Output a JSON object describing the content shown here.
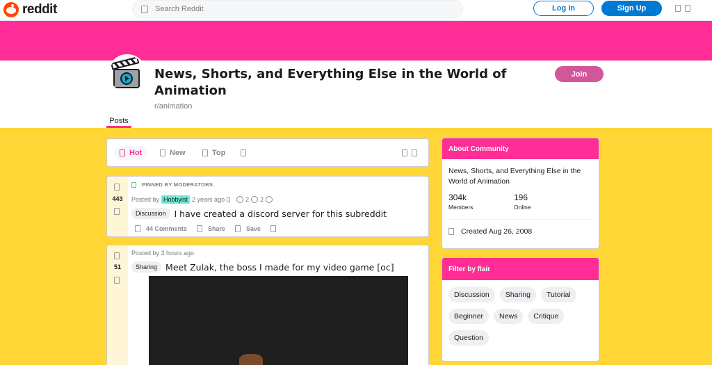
{
  "header": {
    "logo_text": "reddit",
    "search_placeholder": "Search Reddit",
    "login_label": "Log In",
    "signup_label": "Sign Up"
  },
  "colors": {
    "banner": "#ff2d95",
    "background": "#ffd635",
    "join_button": "#d2579a",
    "primary_blue": "#0079d3"
  },
  "subreddit": {
    "title": "News, Shorts, and Everything Else in the World of Animation",
    "name": "r/animation",
    "join_label": "Join",
    "tab_posts": "Posts"
  },
  "sort": {
    "hot": "Hot",
    "new": "New",
    "top": "Top"
  },
  "posts": [
    {
      "score": "443",
      "pinned_label": "PINNED BY MODERATORS",
      "posted_by": "Posted by",
      "author": "Hobbyist",
      "time": "2 years ago",
      "award_count_1": "2",
      "award_count_2": "2",
      "flair": "Discussion",
      "title": "I have created a discord server for this subreddit",
      "comments": "44 Comments",
      "share": "Share",
      "save": "Save"
    },
    {
      "score": "51",
      "posted_by": "Posted by 3 hours ago",
      "flair": "Sharing",
      "title": "Meet Zulak, the boss I made for my video game [oc]"
    }
  ],
  "about": {
    "heading": "About Community",
    "description": "News, Shorts, and Everything Else in the World of Animation",
    "members_count": "304k",
    "members_label": "Members",
    "online_count": "196",
    "online_label": "Online",
    "created": "Created Aug 26, 2008"
  },
  "flair_filter": {
    "heading": "Filter by flair",
    "flairs": [
      "Discussion",
      "Sharing",
      "Tutorial",
      "Beginner",
      "News",
      "Critique",
      "Question"
    ]
  }
}
